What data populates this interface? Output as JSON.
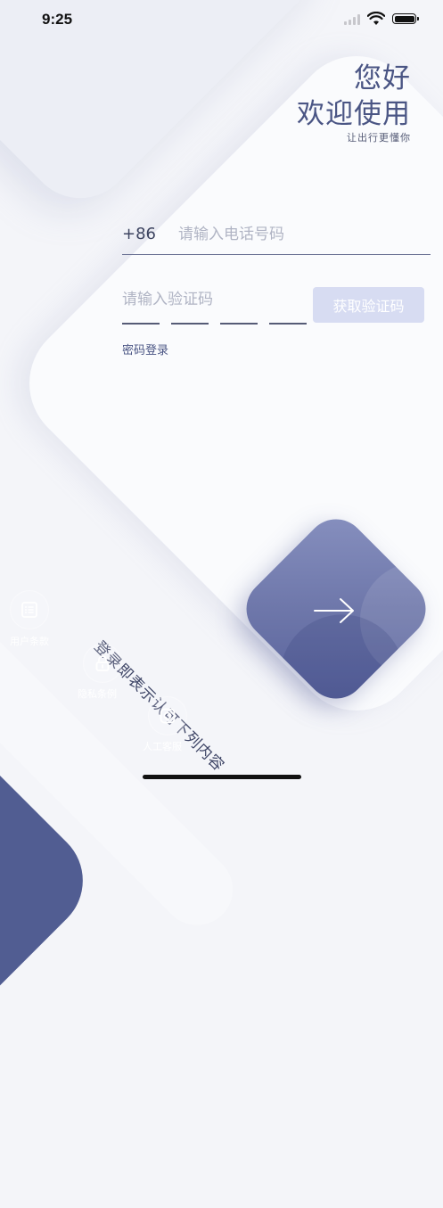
{
  "status_bar": {
    "time": "9:25"
  },
  "greeting": {
    "line1": "您好",
    "line2": "欢迎使用",
    "subtitle": "让出行更懂你"
  },
  "phone": {
    "country_code": "+86",
    "value": "",
    "placeholder": "请输入电话号码"
  },
  "verify": {
    "value": "",
    "placeholder": "请输入验证码",
    "get_code_label": "获取验证码",
    "code_length": 4
  },
  "password_login_label": "密码登录",
  "terms": {
    "notice": "登录即表示认可下列内容",
    "items": [
      {
        "label": "用户条款",
        "icon": "list-icon"
      },
      {
        "label": "隐私条例",
        "icon": "lock-icon"
      },
      {
        "label": "人工客服",
        "icon": "camera-icon"
      }
    ]
  },
  "colors": {
    "primary": "#515d92",
    "accent": "#4a5584",
    "button_disabled": "#d7dcf2",
    "background": "#f4f5f9"
  }
}
